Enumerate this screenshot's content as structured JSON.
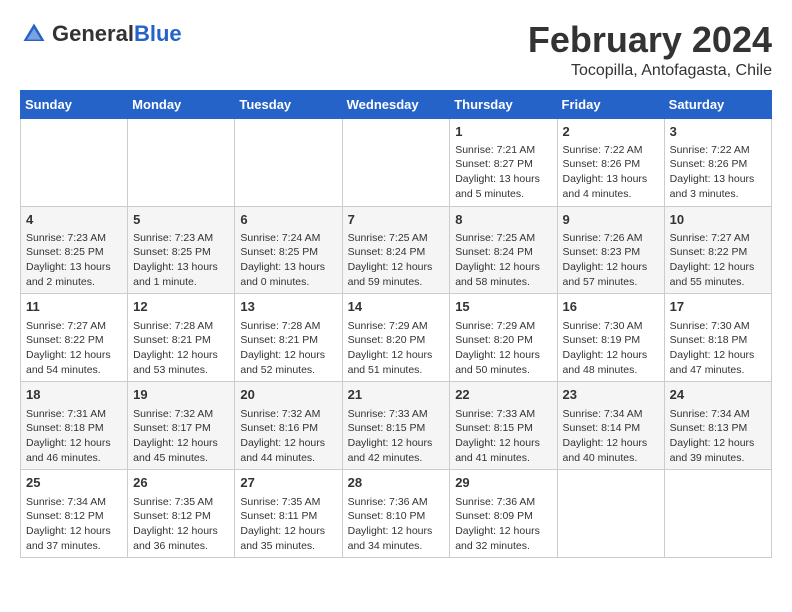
{
  "header": {
    "logo": {
      "general": "General",
      "blue": "Blue"
    },
    "title": "February 2024",
    "location": "Tocopilla, Antofagasta, Chile"
  },
  "calendar": {
    "days_of_week": [
      "Sunday",
      "Monday",
      "Tuesday",
      "Wednesday",
      "Thursday",
      "Friday",
      "Saturday"
    ],
    "weeks": [
      [
        {
          "day": "",
          "info": ""
        },
        {
          "day": "",
          "info": ""
        },
        {
          "day": "",
          "info": ""
        },
        {
          "day": "",
          "info": ""
        },
        {
          "day": "1",
          "sunrise": "Sunrise: 7:21 AM",
          "sunset": "Sunset: 8:27 PM",
          "daylight": "Daylight: 13 hours and 5 minutes."
        },
        {
          "day": "2",
          "sunrise": "Sunrise: 7:22 AM",
          "sunset": "Sunset: 8:26 PM",
          "daylight": "Daylight: 13 hours and 4 minutes."
        },
        {
          "day": "3",
          "sunrise": "Sunrise: 7:22 AM",
          "sunset": "Sunset: 8:26 PM",
          "daylight": "Daylight: 13 hours and 3 minutes."
        }
      ],
      [
        {
          "day": "4",
          "sunrise": "Sunrise: 7:23 AM",
          "sunset": "Sunset: 8:25 PM",
          "daylight": "Daylight: 13 hours and 2 minutes."
        },
        {
          "day": "5",
          "sunrise": "Sunrise: 7:23 AM",
          "sunset": "Sunset: 8:25 PM",
          "daylight": "Daylight: 13 hours and 1 minute."
        },
        {
          "day": "6",
          "sunrise": "Sunrise: 7:24 AM",
          "sunset": "Sunset: 8:25 PM",
          "daylight": "Daylight: 13 hours and 0 minutes."
        },
        {
          "day": "7",
          "sunrise": "Sunrise: 7:25 AM",
          "sunset": "Sunset: 8:24 PM",
          "daylight": "Daylight: 12 hours and 59 minutes."
        },
        {
          "day": "8",
          "sunrise": "Sunrise: 7:25 AM",
          "sunset": "Sunset: 8:24 PM",
          "daylight": "Daylight: 12 hours and 58 minutes."
        },
        {
          "day": "9",
          "sunrise": "Sunrise: 7:26 AM",
          "sunset": "Sunset: 8:23 PM",
          "daylight": "Daylight: 12 hours and 57 minutes."
        },
        {
          "day": "10",
          "sunrise": "Sunrise: 7:27 AM",
          "sunset": "Sunset: 8:22 PM",
          "daylight": "Daylight: 12 hours and 55 minutes."
        }
      ],
      [
        {
          "day": "11",
          "sunrise": "Sunrise: 7:27 AM",
          "sunset": "Sunset: 8:22 PM",
          "daylight": "Daylight: 12 hours and 54 minutes."
        },
        {
          "day": "12",
          "sunrise": "Sunrise: 7:28 AM",
          "sunset": "Sunset: 8:21 PM",
          "daylight": "Daylight: 12 hours and 53 minutes."
        },
        {
          "day": "13",
          "sunrise": "Sunrise: 7:28 AM",
          "sunset": "Sunset: 8:21 PM",
          "daylight": "Daylight: 12 hours and 52 minutes."
        },
        {
          "day": "14",
          "sunrise": "Sunrise: 7:29 AM",
          "sunset": "Sunset: 8:20 PM",
          "daylight": "Daylight: 12 hours and 51 minutes."
        },
        {
          "day": "15",
          "sunrise": "Sunrise: 7:29 AM",
          "sunset": "Sunset: 8:20 PM",
          "daylight": "Daylight: 12 hours and 50 minutes."
        },
        {
          "day": "16",
          "sunrise": "Sunrise: 7:30 AM",
          "sunset": "Sunset: 8:19 PM",
          "daylight": "Daylight: 12 hours and 48 minutes."
        },
        {
          "day": "17",
          "sunrise": "Sunrise: 7:30 AM",
          "sunset": "Sunset: 8:18 PM",
          "daylight": "Daylight: 12 hours and 47 minutes."
        }
      ],
      [
        {
          "day": "18",
          "sunrise": "Sunrise: 7:31 AM",
          "sunset": "Sunset: 8:18 PM",
          "daylight": "Daylight: 12 hours and 46 minutes."
        },
        {
          "day": "19",
          "sunrise": "Sunrise: 7:32 AM",
          "sunset": "Sunset: 8:17 PM",
          "daylight": "Daylight: 12 hours and 45 minutes."
        },
        {
          "day": "20",
          "sunrise": "Sunrise: 7:32 AM",
          "sunset": "Sunset: 8:16 PM",
          "daylight": "Daylight: 12 hours and 44 minutes."
        },
        {
          "day": "21",
          "sunrise": "Sunrise: 7:33 AM",
          "sunset": "Sunset: 8:15 PM",
          "daylight": "Daylight: 12 hours and 42 minutes."
        },
        {
          "day": "22",
          "sunrise": "Sunrise: 7:33 AM",
          "sunset": "Sunset: 8:15 PM",
          "daylight": "Daylight: 12 hours and 41 minutes."
        },
        {
          "day": "23",
          "sunrise": "Sunrise: 7:34 AM",
          "sunset": "Sunset: 8:14 PM",
          "daylight": "Daylight: 12 hours and 40 minutes."
        },
        {
          "day": "24",
          "sunrise": "Sunrise: 7:34 AM",
          "sunset": "Sunset: 8:13 PM",
          "daylight": "Daylight: 12 hours and 39 minutes."
        }
      ],
      [
        {
          "day": "25",
          "sunrise": "Sunrise: 7:34 AM",
          "sunset": "Sunset: 8:12 PM",
          "daylight": "Daylight: 12 hours and 37 minutes."
        },
        {
          "day": "26",
          "sunrise": "Sunrise: 7:35 AM",
          "sunset": "Sunset: 8:12 PM",
          "daylight": "Daylight: 12 hours and 36 minutes."
        },
        {
          "day": "27",
          "sunrise": "Sunrise: 7:35 AM",
          "sunset": "Sunset: 8:11 PM",
          "daylight": "Daylight: 12 hours and 35 minutes."
        },
        {
          "day": "28",
          "sunrise": "Sunrise: 7:36 AM",
          "sunset": "Sunset: 8:10 PM",
          "daylight": "Daylight: 12 hours and 34 minutes."
        },
        {
          "day": "29",
          "sunrise": "Sunrise: 7:36 AM",
          "sunset": "Sunset: 8:09 PM",
          "daylight": "Daylight: 12 hours and 32 minutes."
        },
        {
          "day": "",
          "info": ""
        },
        {
          "day": "",
          "info": ""
        }
      ]
    ]
  }
}
